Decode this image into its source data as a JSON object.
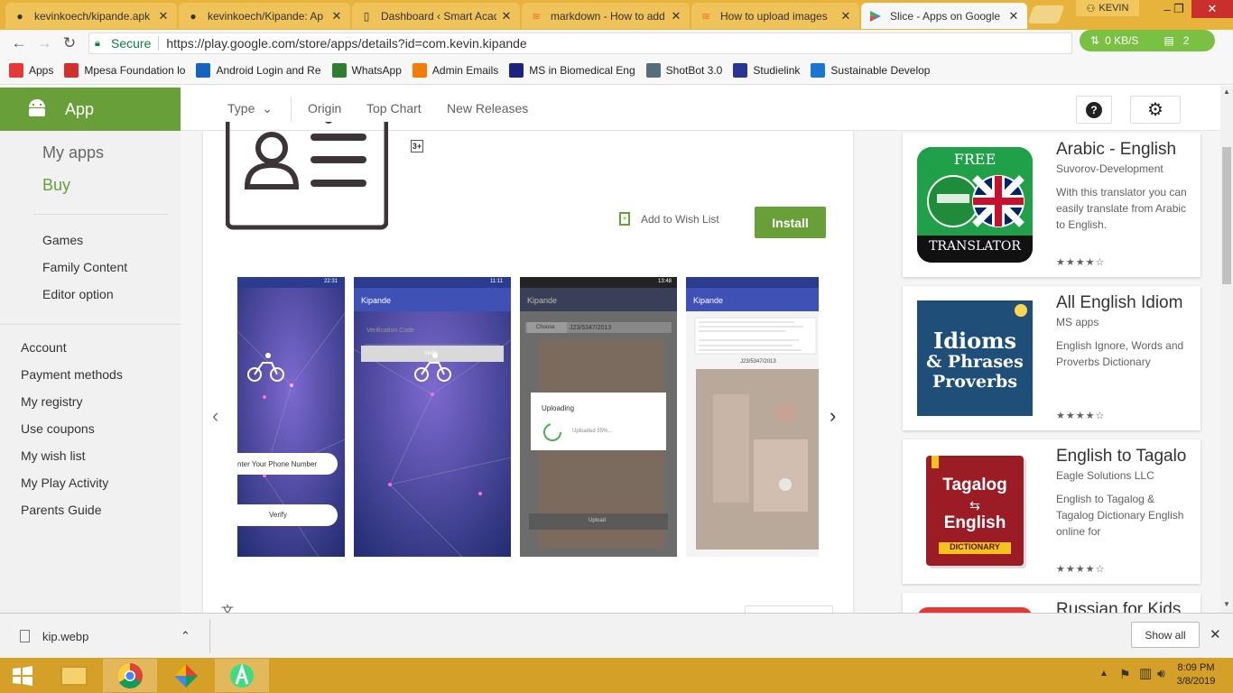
{
  "browser": {
    "tabs": [
      {
        "title": "kevinkoech/kipande.apk",
        "icon": "github-icon"
      },
      {
        "title": "kevinkoech/Kipande: Ap",
        "icon": "github-icon"
      },
      {
        "title": "Dashboard ‹ Smart Acad",
        "icon": "page-icon"
      },
      {
        "title": "markdown - How to add",
        "icon": "stackoverflow-icon"
      },
      {
        "title": "How to upload images",
        "icon": "stackoverflow-icon"
      },
      {
        "title": "Slice - Apps on Google",
        "icon": "play-icon"
      }
    ],
    "window_user": "KEVIN",
    "secure_label": "Secure",
    "url": "https://play.google.com/store/apps/details?id=com.kevin.kipande",
    "net_speed": "0 KB/S",
    "net_count": "2"
  },
  "bookmarks": [
    {
      "label": "Apps",
      "color": "#e53935"
    },
    {
      "label": "Mpesa Foundation lo",
      "color": "#d32f2f"
    },
    {
      "label": "Android Login and Re",
      "color": "#1565c0"
    },
    {
      "label": "WhatsApp",
      "color": "#2e7d32"
    },
    {
      "label": "Admin Emails",
      "color": "#f57c00"
    },
    {
      "label": "MS in Biomedical Eng",
      "color": "#1a237e"
    },
    {
      "label": "ShotBot 3.0",
      "color": "#546e7a"
    },
    {
      "label": "Studielink",
      "color": "#283593"
    },
    {
      "label": "Sustainable Develop",
      "color": "#1976d2"
    }
  ],
  "store": {
    "section": "App",
    "nav_my_apps": "My apps",
    "nav_buy": "Buy",
    "sub_items": [
      "Games",
      "Family Content",
      "Editor option"
    ],
    "account_items": [
      "Account",
      "Payment methods",
      "My registry",
      "Use coupons",
      "My wish list",
      "My Play Activity",
      "Parents Guide"
    ],
    "top_nav": {
      "type": "Type",
      "origin": "Origin",
      "top_chart": "Top Chart",
      "new_releases": "New Releases"
    },
    "rating_badge": "3+",
    "wishlist": "Add to Wish List",
    "install": "Install",
    "shots": {
      "time1": "22:31",
      "time2": "11:11",
      "time3": "13:48",
      "app_title": "Kipande",
      "phone_placeholder": "nter Your Phone Number",
      "verify": "Verify",
      "verification_code": "Verification Code",
      "choose": "Choose",
      "reg_number": "J23/5347/2013",
      "uploading": "Uploading",
      "uploaded": "Uploaded 55%...",
      "upload": "Upload"
    }
  },
  "similar_apps": [
    {
      "title": "Arabic - English",
      "dev": "Suvorov-Development",
      "desc": "With this translator you can easily translate from Arabic to English.",
      "stars": "★★★★☆"
    },
    {
      "title": "All English Idiom",
      "dev": "MS apps",
      "desc": "English Ignore, Words and Proverbs Dictionary",
      "stars": "★★★★☆"
    },
    {
      "title": "English to Tagalo",
      "dev": "Eagle Solutions LLC",
      "desc": "English to Tagalog & Tagalog Dictionary English online for",
      "stars": "★★★★☆"
    },
    {
      "title": "Russian for Kids",
      "dev": "",
      "desc": "",
      "stars": ""
    }
  ],
  "icon_labels": {
    "free": "FREE",
    "translator": "TRANSLATOR",
    "idioms": "Idioms",
    "phrases": "& Phrases",
    "proverbs": "Proverbs",
    "tagalog": "Tagalog",
    "english": "English",
    "dictionary": "DICTIONARY"
  },
  "downloads": {
    "file": "kip.webp",
    "show_all": "Show all"
  },
  "taskbar": {
    "time": "8:09 PM",
    "date": "3/8/2019"
  }
}
